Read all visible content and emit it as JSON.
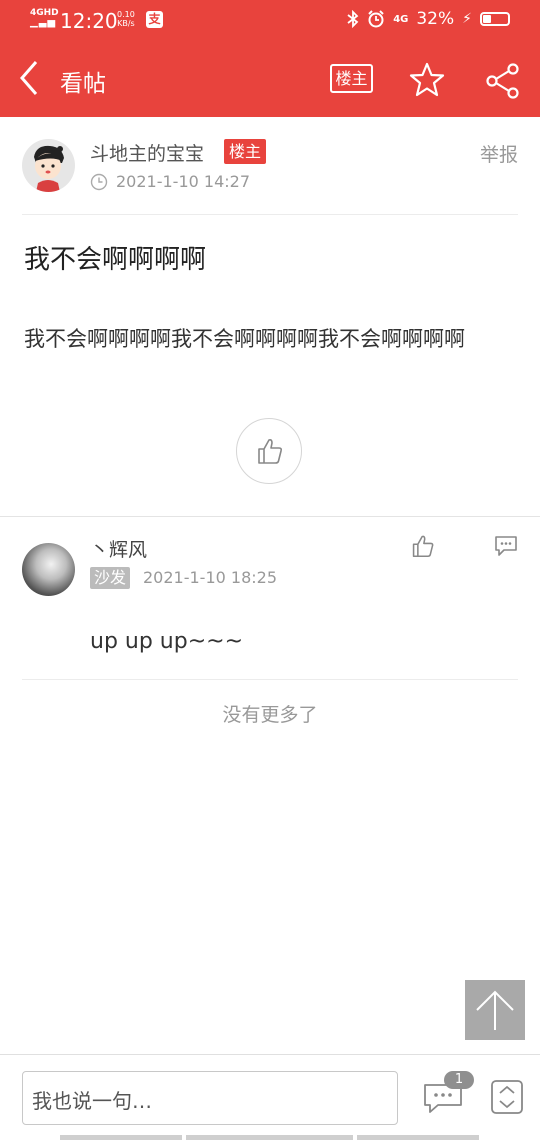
{
  "status_bar": {
    "signal": "4GHD",
    "time": "12:20",
    "net_speed": "0.10",
    "net_unit": "KB/s",
    "app_badge": "支",
    "network": "4G",
    "battery": "32%",
    "battery_level": 0.32
  },
  "navbar": {
    "title": "看帖",
    "owner_button": "楼主"
  },
  "post": {
    "author": "斗地主的宝宝",
    "owner_tag": "楼主",
    "report": "举报",
    "time": "2021-1-10 14:27",
    "title": "我不会啊啊啊啊",
    "content": "我不会啊啊啊啊我不会啊啊啊啊我不会啊啊啊啊"
  },
  "reply": {
    "name": "丶辉风",
    "floor_tag": "沙发",
    "time": "2021-1-10 18:25",
    "text": "up up up~~~"
  },
  "no_more": "没有更多了",
  "bottom": {
    "input_placeholder": "我也说一句…",
    "comment_count": "1"
  },
  "colors": {
    "brand_red": "#e8433d",
    "muted_gray": "#999999"
  }
}
